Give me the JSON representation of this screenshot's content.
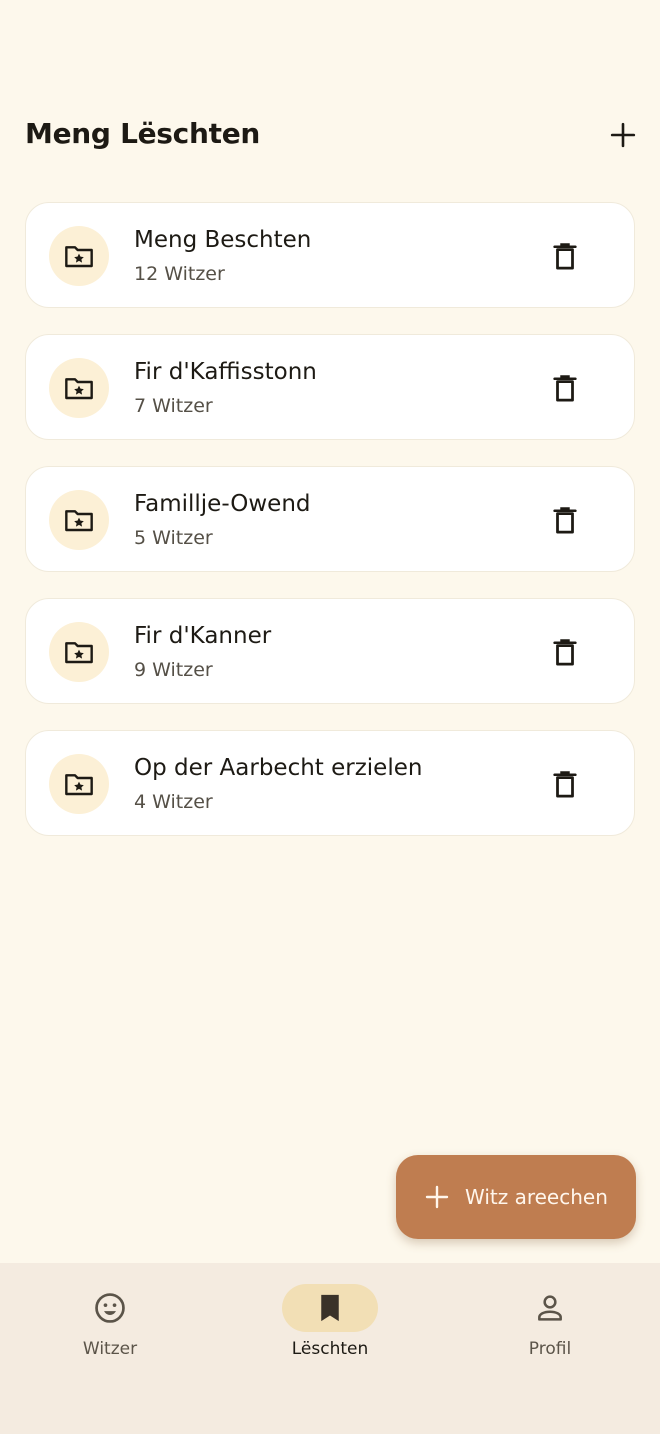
{
  "header": {
    "title": "Meng Lëschten"
  },
  "lists": [
    {
      "name": "Meng Beschten",
      "count": "12 Witzer"
    },
    {
      "name": "Fir d'Kaffisstonn",
      "count": "7 Witzer"
    },
    {
      "name": "Famillje-Owend",
      "count": "5 Witzer"
    },
    {
      "name": "Fir d'Kanner",
      "count": "9 Witzer"
    },
    {
      "name": "Op der Aarbecht erzielen",
      "count": "4 Witzer"
    }
  ],
  "fab": {
    "label": "Witz areechen"
  },
  "nav": {
    "items": [
      {
        "label": "Witzer",
        "icon": "smiley-icon"
      },
      {
        "label": "Lëschten",
        "icon": "bookmark-icon",
        "active": true
      },
      {
        "label": "Profil",
        "icon": "person-icon"
      }
    ]
  },
  "colors": {
    "background": "#fdf8ec",
    "accent": "#bf7d50",
    "nav_background": "#f4ebe0",
    "nav_active_pill": "#f2dfb5",
    "icon_circle": "#fcf0d6"
  }
}
